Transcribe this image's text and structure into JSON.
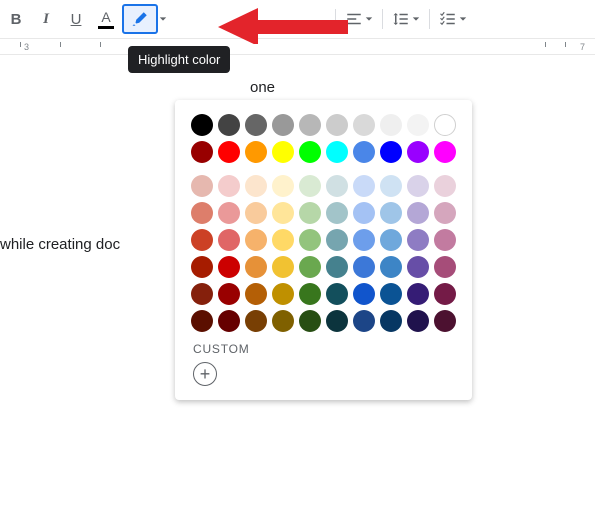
{
  "toolbar": {
    "bold": "B",
    "italic": "I",
    "underline": "U",
    "textcolor": "A"
  },
  "tooltip": "Highlight color",
  "ruler": {
    "marks": [
      "3",
      "7"
    ]
  },
  "doc": {
    "line1": "one",
    "line2": "while creating doc"
  },
  "palette": {
    "none_label": "",
    "custom_label": "CUSTOM",
    "rows": [
      [
        "#000000",
        "#434343",
        "#666666",
        "#999999",
        "#b7b7b7",
        "#cccccc",
        "#d9d9d9",
        "#efefef",
        "#f3f3f3",
        "#ffffff"
      ],
      [
        "#980000",
        "#ff0000",
        "#ff9900",
        "#ffff00",
        "#00ff00",
        "#00ffff",
        "#4a86e8",
        "#0000ff",
        "#9900ff",
        "#ff00ff"
      ],
      [
        "#e6b8af",
        "#f4cccc",
        "#fce5cd",
        "#fff2cc",
        "#d9ead3",
        "#d0e0e3",
        "#c9daf8",
        "#cfe2f3",
        "#d9d2e9",
        "#ead1dc"
      ],
      [
        "#dd7e6b",
        "#ea9999",
        "#f9cb9c",
        "#ffe599",
        "#b6d7a8",
        "#a2c4c9",
        "#a4c2f4",
        "#9fc5e8",
        "#b4a7d6",
        "#d5a6bd"
      ],
      [
        "#cc4125",
        "#e06666",
        "#f6b26b",
        "#ffd966",
        "#93c47d",
        "#76a5af",
        "#6d9eeb",
        "#6fa8dc",
        "#8e7cc3",
        "#c27ba0"
      ],
      [
        "#a61c00",
        "#cc0000",
        "#e69138",
        "#f1c232",
        "#6aa84f",
        "#45818e",
        "#3c78d8",
        "#3d85c6",
        "#674ea7",
        "#a64d79"
      ],
      [
        "#85200c",
        "#990000",
        "#b45f06",
        "#bf9000",
        "#38761d",
        "#134f5c",
        "#1155cc",
        "#0b5394",
        "#351c75",
        "#741b47"
      ],
      [
        "#5b0f00",
        "#660000",
        "#783f04",
        "#7f6000",
        "#274e13",
        "#0c343d",
        "#1c4587",
        "#073763",
        "#20124d",
        "#4c1130"
      ]
    ]
  }
}
